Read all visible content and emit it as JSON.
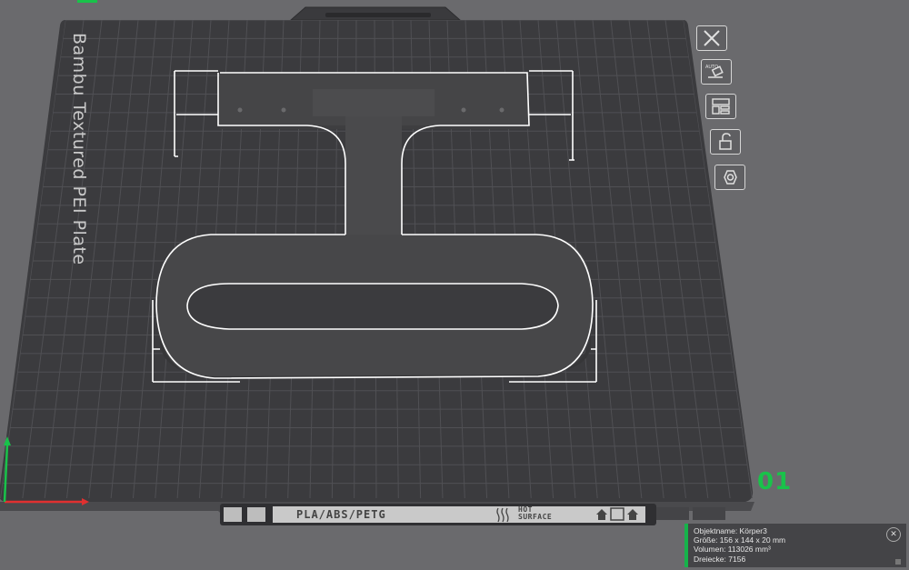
{
  "plate": {
    "label": "Bambu Textured PEI Plate",
    "number": "01",
    "material_strip": "PLA/ABS/PETG",
    "surface_line1": "HOT",
    "surface_line2": "SURFACE"
  },
  "toolbar": [
    {
      "name": "delete-plate-button",
      "icon": "close-icon"
    },
    {
      "name": "auto-orient-button",
      "icon": "auto-orient-icon",
      "badge": "AUTO"
    },
    {
      "name": "arrange-button",
      "icon": "arrange-icon"
    },
    {
      "name": "lock-plate-button",
      "icon": "unlock-icon"
    },
    {
      "name": "plate-settings-button",
      "icon": "hex-nut-icon"
    }
  ],
  "object_info": {
    "name_line": "Objektname: Körper3",
    "size_line": "Größe: 156 x 144 x 20 mm",
    "volume_line": "Volumen: 113026 mm³",
    "triangles_line": "Dreiecke: 7156"
  },
  "colors": {
    "background": "#6a6a6d",
    "plate": "#3b3b3e",
    "grid": "#505054",
    "model": "#4a4a4c",
    "selection": "#ffffff",
    "accent": "#19c24a",
    "axis_x": "#e03030",
    "axis_y": "#19c24a"
  }
}
